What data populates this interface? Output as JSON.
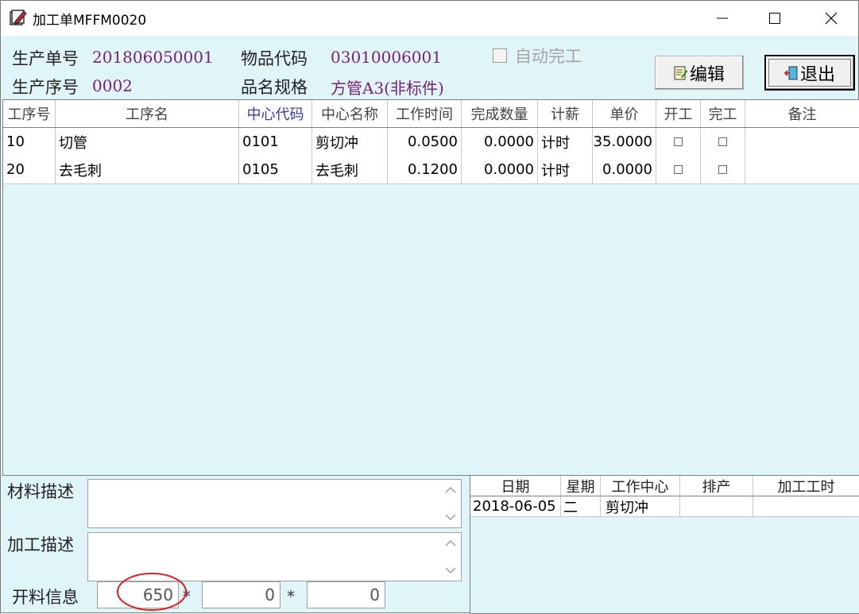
{
  "window": {
    "title": "加工单MFFM0020",
    "icon": "edit-document-icon"
  },
  "header": {
    "order_no_label": "生产单号",
    "order_no_value": "201806050001",
    "seq_no_label": "生产序号",
    "seq_no_value": "0002",
    "item_code_label": "物品代码",
    "item_code_value": "03010006001",
    "item_spec_label": "品名规格",
    "item_spec_value": "方管A3(非标件)",
    "auto_complete_label": "自动完工",
    "edit_button": "编辑",
    "exit_button": "退出"
  },
  "process_grid": {
    "columns": [
      "工序号",
      "工序名",
      "中心代码",
      "中心名称",
      "工作时间",
      "完成数量",
      "计薪",
      "单价",
      "开工",
      "完工",
      "备注"
    ],
    "rows": [
      {
        "seq": "10",
        "name": "切管",
        "center_code": "0101",
        "center_name": "剪切冲",
        "work_time": "0.0500",
        "done_qty": "0.0000",
        "pay": "计时",
        "price": "35.0000",
        "start": false,
        "finish": false,
        "note": ""
      },
      {
        "seq": "20",
        "name": "去毛刺",
        "center_code": "0105",
        "center_name": "去毛刺",
        "work_time": "0.1200",
        "done_qty": "0.0000",
        "pay": "计时",
        "price": "0.0000",
        "start": false,
        "finish": false,
        "note": ""
      }
    ]
  },
  "bottom": {
    "material_desc_label": "材料描述",
    "material_desc_value": "",
    "process_desc_label": "加工描述",
    "process_desc_value": "",
    "cutting_label": "开料信息",
    "cut_1": "650",
    "cut_2": "0",
    "cut_3": "0",
    "mult": "*"
  },
  "schedule_grid": {
    "columns": [
      "日期",
      "星期",
      "工作中心",
      "排产",
      "加工工时"
    ],
    "rows": [
      {
        "date": "2018-06-05",
        "weekday": "二",
        "center": "剪切冲",
        "plan": "",
        "hours": ""
      }
    ]
  },
  "colors": {
    "panel_bg": "#dff5f8",
    "value_text": "#7b1f7b",
    "annotation": "#e02020"
  }
}
